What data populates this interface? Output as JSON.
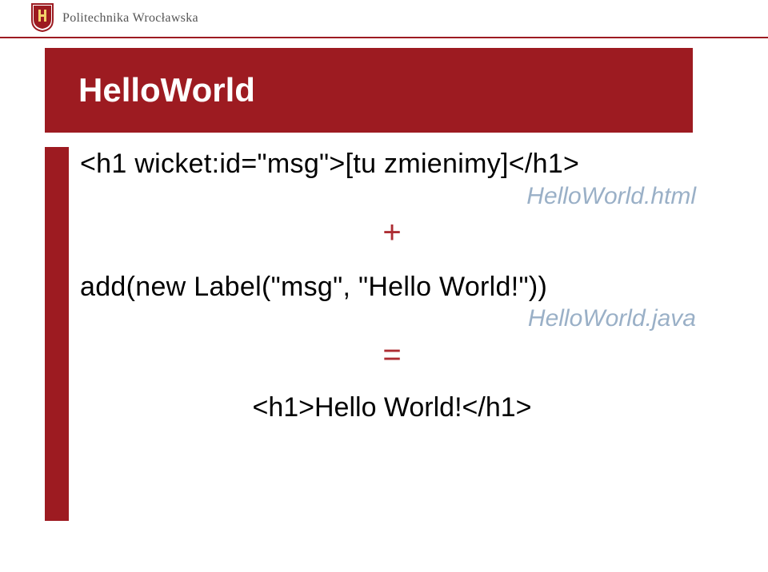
{
  "header": {
    "institution": "Politechnika Wrocławska"
  },
  "slide": {
    "title": "HelloWorld",
    "line1": "<h1 wicket:id=\"msg\">[tu zmienimy]</h1>",
    "note1": "HelloWorld.html",
    "plus": "+",
    "line2": "add(new Label(\"msg\", \"Hello World!\"))",
    "note2": "HelloWorld.java",
    "equals": "=",
    "result": "<h1>Hello World!</h1>"
  },
  "colors": {
    "brand": "#9d1b21",
    "note": "#9ab0c7"
  }
}
